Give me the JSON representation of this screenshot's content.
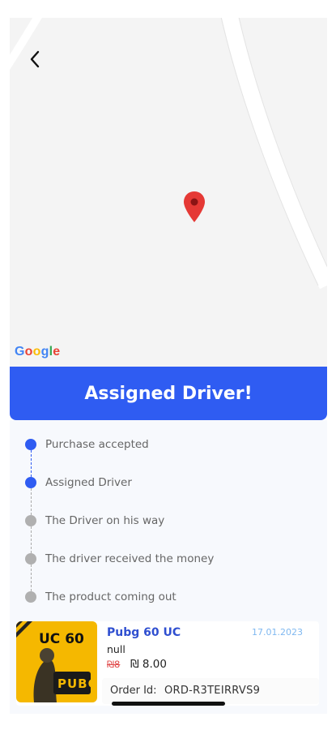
{
  "header": {
    "back_icon": "chevron-left-icon"
  },
  "map": {
    "pin_icon": "map-pin-icon",
    "pin_color": "#e53935",
    "attribution": [
      "G",
      "o",
      "o",
      "g",
      "l",
      "e"
    ],
    "attribution_colors": [
      "#4285F4",
      "#EA4335",
      "#FBBC05",
      "#4285F4",
      "#34A853",
      "#EA4335"
    ]
  },
  "banner": {
    "title": "Assigned Driver!",
    "color": "#2f5cf2"
  },
  "steps": [
    {
      "label": "Purchase accepted",
      "done": true
    },
    {
      "label": "Assigned Driver",
      "done": true
    },
    {
      "label": "The Driver on his way",
      "done": false
    },
    {
      "label": "The driver received the money",
      "done": false
    },
    {
      "label": "The product coming out",
      "done": false
    }
  ],
  "step_colors": {
    "done": "#2f5cf2",
    "pending": "#b0b0b0"
  },
  "order": {
    "thumbnail_title": "UC 60",
    "thumbnail_logo": "PUBG",
    "product_name": "Pubg 60 UC",
    "date": "17.01.2023",
    "description": "null",
    "old_price": "₪8",
    "price": "₪ 8.00",
    "order_id_label": "Order Id:",
    "order_id": "ORD-R3TEIRRVS9"
  }
}
